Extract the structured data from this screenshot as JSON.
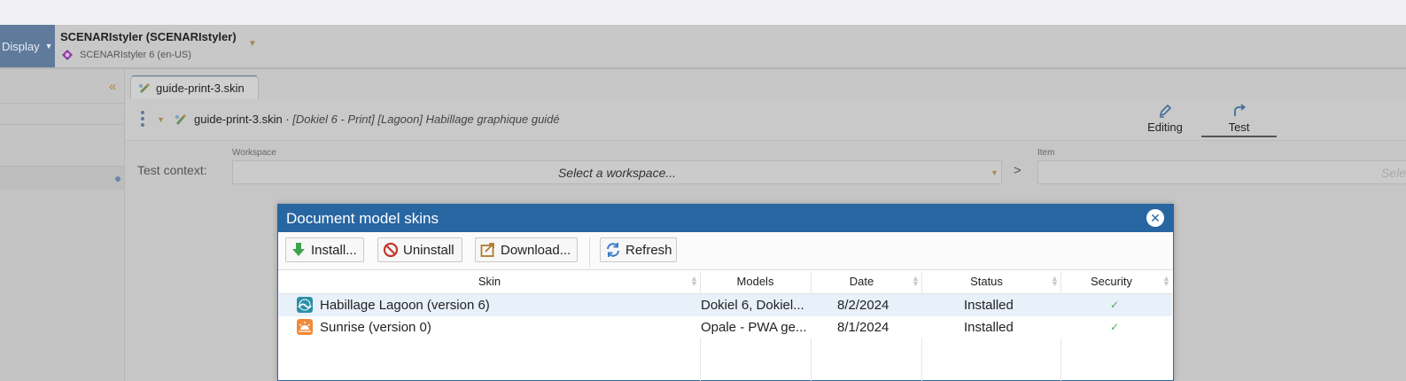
{
  "header": {
    "display_label": "Display",
    "app_title": "SCENARIstyler (SCENARIstyler)",
    "app_subtitle": "SCENARIstyler 6 (en-US)"
  },
  "editor": {
    "tab_label": "guide-print-3.skin",
    "item_name": "guide-print-3.skin ·",
    "item_description": "[Dokiel 6 - Print] [Lagoon] Habillage graphique guidé",
    "view_tabs": [
      {
        "label": "Editing",
        "icon": "pen-icon",
        "active": false
      },
      {
        "label": "Test",
        "icon": "redo-arrow-icon",
        "active": true
      }
    ],
    "test_context_label": "Test context:",
    "workspace_label": "Workspace",
    "workspace_placeholder": "Select a workspace...",
    "separator": ">",
    "item_label": "Item",
    "item_placeholder": "Sele"
  },
  "dialog": {
    "title": "Document model skins",
    "toolbar": {
      "install": "Install...",
      "uninstall": "Uninstall",
      "download": "Download...",
      "refresh": "Refresh"
    },
    "columns": [
      "Skin",
      "Models",
      "Date",
      "Status",
      "Security"
    ],
    "rows": [
      {
        "skin": "Habillage Lagoon (version 6)",
        "models": "Dokiel 6, Dokiel...",
        "date": "8/2/2024",
        "status": "Installed",
        "security": "✓",
        "icon_color": "#2a8fa8"
      },
      {
        "skin": "Sunrise (version 0)",
        "models": "Opale - PWA ge...",
        "date": "8/1/2024",
        "status": "Installed",
        "security": "✓",
        "icon_color": "#f08a3a"
      }
    ]
  },
  "colors": {
    "dialog_header": "#2866a2",
    "display_button": "#5f7a9b",
    "check": "#4caf50"
  }
}
